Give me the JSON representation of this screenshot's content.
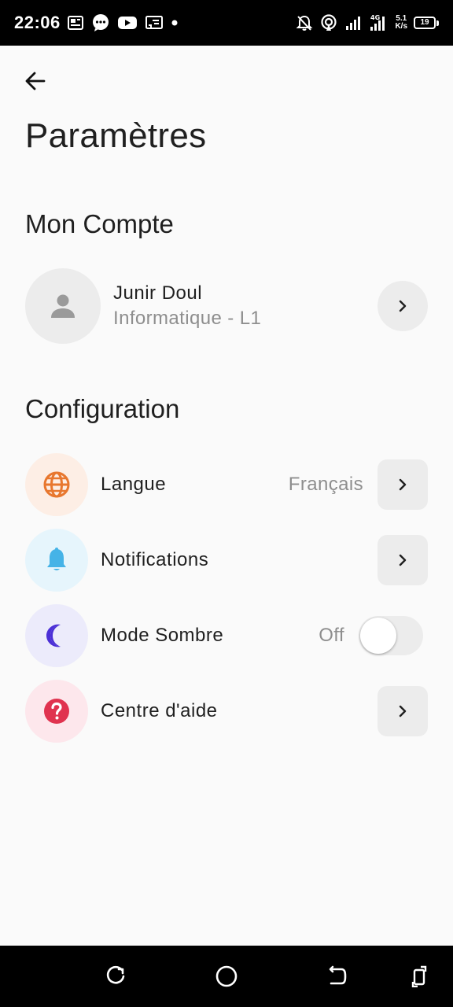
{
  "status_bar": {
    "time": "22:06",
    "net_speed_value": "5.1",
    "net_speed_unit": "K/s",
    "network_type": "4G",
    "battery_level": "19",
    "left_icons": [
      "news-icon",
      "message-icon",
      "youtube-icon",
      "cast-icon",
      "dot-icon"
    ],
    "right_icons": [
      "bell-off-icon",
      "hotspot-icon",
      "signal-icon",
      "signal-4g-icon"
    ]
  },
  "header": {
    "back_icon": "arrow-left-icon",
    "title": "Paramètres"
  },
  "account_section": {
    "title": "Mon Compte",
    "user_name": "Junir Doul",
    "user_subtitle": "Informatique - L1",
    "avatar_icon": "person-icon",
    "chevron_icon": "chevron-right-icon"
  },
  "config_section": {
    "title": "Configuration",
    "items": [
      {
        "label": "Langue",
        "value": "Français",
        "icon": "globe-icon",
        "icon_color": "#e8772e",
        "icon_bg": "#fdeee5"
      },
      {
        "label": "Notifications",
        "icon": "bell-icon",
        "icon_color": "#45b3e7",
        "icon_bg": "#e6f5fc"
      },
      {
        "label": "Mode Sombre",
        "value": "Off",
        "toggle_on": false,
        "icon": "moon-icon",
        "icon_color": "#4b2fd6",
        "icon_bg": "#ecebfb"
      },
      {
        "label": "Centre d'aide",
        "icon": "help-icon",
        "icon_color": "#e0334f",
        "icon_bg": "#fde7ec"
      }
    ]
  },
  "nav_bar": {
    "buttons": [
      "recents-icon",
      "home-icon",
      "back-icon",
      "rotate-icon"
    ]
  },
  "colors": {
    "background": "#fafafa",
    "muted_text": "#8e8e8e",
    "button_bg": "#ececec"
  }
}
